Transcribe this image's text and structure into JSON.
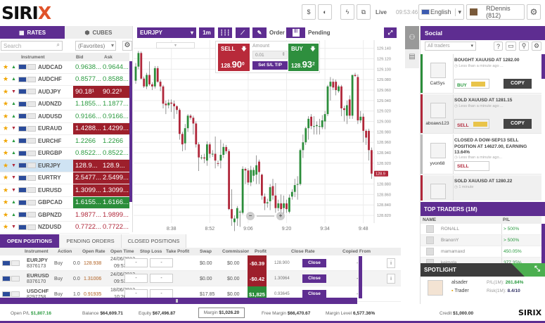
{
  "header": {
    "logo": "SIRIX",
    "live": "Live",
    "clock": "09:53:46",
    "language": "English",
    "user": "RDennis (812)"
  },
  "rates": {
    "tabs": [
      "RATES",
      "CUBES"
    ],
    "search_placeholder": "Search",
    "filter": "(Favorites)",
    "columns": [
      "Instrument",
      "Bid",
      "Ask"
    ],
    "rows": [
      {
        "ins": "AUDCAD",
        "dir": "up",
        "bid": "0.9638...",
        "ask": "0.9644...",
        "style": "up"
      },
      {
        "ins": "AUDCHF",
        "dir": "up",
        "bid": "0.8577...",
        "ask": "0.8588...",
        "style": "up"
      },
      {
        "ins": "AUDJPY",
        "dir": "down",
        "bid": "90.18¹",
        "ask": "90.22³",
        "style": "red"
      },
      {
        "ins": "AUDNZD",
        "dir": "up",
        "bid": "1.1855...",
        "ask": "1.1877...",
        "style": "up"
      },
      {
        "ins": "AUDUSD",
        "dir": "up",
        "bid": "0.9166...",
        "ask": "0.9166...",
        "style": "up"
      },
      {
        "ins": "EURAUD",
        "dir": "down",
        "bid": "1.4288...",
        "ask": "1.4299...",
        "style": "red"
      },
      {
        "ins": "EURCHF",
        "dir": "up",
        "bid": "1.2266",
        "ask": "1.2266",
        "style": "up"
      },
      {
        "ins": "EURGBP",
        "dir": "up",
        "bid": "0.8522...",
        "ask": "0.8522...",
        "style": "up"
      },
      {
        "ins": "EURJPY",
        "dir": "down",
        "bid": "128.9...",
        "ask": "128.9...",
        "style": "red"
      },
      {
        "ins": "EURTRY",
        "dir": "down",
        "bid": "2.5477...",
        "ask": "2.5499...",
        "style": "red"
      },
      {
        "ins": "EURUSD",
        "dir": "down",
        "bid": "1.3099...",
        "ask": "1.3099...",
        "style": "red"
      },
      {
        "ins": "GBPCAD",
        "dir": "up",
        "bid": "1.6155...",
        "ask": "1.6166...",
        "style": "green"
      },
      {
        "ins": "GBPNZD",
        "dir": "up",
        "bid": "1.9877...",
        "ask": "1.9899...",
        "style": "dn"
      },
      {
        "ins": "NZDUSD",
        "dir": "down",
        "bid": "0.7722...",
        "ask": "0.7722...",
        "style": "dn"
      }
    ]
  },
  "chart_toolbar": {
    "symbol": "EURJPY",
    "timeframe": "1m",
    "order": "Order",
    "pending": "Pending"
  },
  "trade_box": {
    "sell_label": "SELL",
    "sell_price_main": "128.",
    "sell_price_big": "90",
    "sell_price_sup": "0",
    "amount_label": "Amount",
    "amount_value": "0.01",
    "sltp": "Set S/L T/P",
    "buy_label": "BUY",
    "buy_price_main": "128.",
    "buy_price_big": "93",
    "buy_price_sup": "2"
  },
  "chart_data": {
    "type": "candlestick",
    "symbol": "EURJPY",
    "interval": "1m",
    "start_time": "8:25",
    "x_ticks": [
      "8:38",
      "8:52",
      "9:06",
      "9:20",
      "9:34",
      "9:48"
    ],
    "y_ticks": [
      "129.140",
      "129.120",
      "129.100",
      "129.080",
      "129.060",
      "129.040",
      "129.020",
      "129.000",
      "128.980",
      "128.960",
      "128.940",
      "128.920",
      "128.880",
      "128.860",
      "128.840",
      "128.820"
    ],
    "ylim": [
      128.812,
      129.149
    ],
    "current_price_label": "128.9",
    "current_price": 128.9,
    "grid": true,
    "up_color": "#2b8d3a",
    "down_color": "#b0273a",
    "ohlc": [
      [
        129.078,
        129.112,
        129.072,
        129.105
      ],
      [
        129.105,
        129.135,
        129.1,
        129.131
      ],
      [
        129.131,
        129.134,
        129.08,
        129.082
      ],
      [
        129.082,
        129.086,
        129.064,
        129.067
      ],
      [
        129.067,
        129.093,
        129.062,
        129.089
      ],
      [
        129.089,
        129.115,
        129.068,
        129.071
      ],
      [
        129.071,
        129.075,
        129.06,
        129.067
      ],
      [
        129.067,
        129.106,
        129.063,
        129.102
      ],
      [
        129.102,
        129.106,
        129.074,
        129.076
      ],
      [
        129.076,
        129.08,
        129.058,
        129.067
      ],
      [
        129.067,
        129.07,
        129.025,
        129.034
      ],
      [
        129.034,
        129.04,
        129.014,
        129.031
      ],
      [
        129.031,
        129.042,
        129.025,
        129.036
      ],
      [
        129.036,
        129.042,
        129.018,
        129.034
      ],
      [
        129.034,
        129.04,
        129.005,
        129.029
      ],
      [
        129.029,
        129.031,
        129.014,
        129.022
      ],
      [
        129.022,
        129.025,
        128.965,
        128.976
      ],
      [
        128.976,
        128.98,
        128.943,
        128.956
      ],
      [
        128.958,
        128.995,
        128.945,
        128.987
      ],
      [
        128.987,
        129.014,
        128.98,
        129.011
      ],
      [
        129.011,
        129.014,
        129.003,
        129.007
      ],
      [
        129.007,
        129.011,
        128.975,
        128.996
      ],
      [
        128.996,
        129.0,
        128.95,
        128.956
      ],
      [
        128.956,
        128.96,
        128.905,
        128.931
      ],
      [
        128.931,
        128.936,
        128.927,
        128.931
      ],
      [
        128.931,
        128.938,
        128.92,
        128.929
      ],
      [
        128.925,
        128.962,
        128.915,
        128.956
      ],
      [
        128.956,
        128.96,
        128.93,
        128.938
      ],
      [
        128.938,
        128.945,
        128.932,
        128.938
      ],
      [
        128.938,
        128.971,
        128.91,
        128.925
      ],
      [
        128.92,
        128.925,
        128.914,
        128.919
      ],
      [
        128.925,
        128.965,
        128.91,
        128.936
      ],
      [
        128.936,
        128.958,
        128.93,
        128.951
      ],
      [
        128.951,
        128.955,
        128.938,
        128.943
      ],
      [
        128.943,
        128.947,
        128.83,
        128.832
      ],
      [
        128.832,
        128.87,
        128.8,
        128.814
      ],
      [
        128.807,
        128.82,
        128.79,
        128.814
      ],
      [
        128.814,
        128.838,
        128.8,
        128.834
      ],
      [
        128.827,
        128.83,
        128.798,
        128.827
      ],
      [
        128.825,
        128.914,
        128.822,
        128.909
      ],
      [
        128.909,
        128.912,
        128.88,
        128.906
      ],
      [
        128.906,
        128.91,
        128.878,
        128.883
      ],
      [
        128.883,
        128.915,
        128.876,
        128.907
      ],
      [
        128.896,
        128.912,
        128.885,
        128.907
      ],
      [
        128.898,
        128.935,
        128.88,
        128.916
      ],
      [
        128.923,
        128.927,
        128.88,
        128.903
      ],
      [
        128.898,
        128.9,
        128.85,
        128.858
      ],
      [
        128.856,
        128.862,
        128.83,
        128.843
      ],
      [
        128.843,
        128.852,
        128.835,
        128.845
      ],
      [
        128.847,
        128.88,
        128.83,
        128.874
      ],
      [
        128.876,
        128.89,
        128.85,
        128.858
      ],
      [
        128.858,
        128.882,
        128.825,
        128.834
      ],
      [
        128.834,
        128.85,
        128.828,
        128.843
      ],
      [
        128.843,
        128.86,
        128.822,
        128.832
      ],
      [
        128.834,
        128.858,
        128.82,
        128.843
      ],
      [
        128.843,
        128.85,
        128.825,
        128.832
      ],
      [
        128.827,
        128.86,
        128.824,
        128.854
      ],
      [
        128.856,
        128.87,
        128.85,
        128.865
      ],
      [
        128.865,
        128.89,
        128.855,
        128.878
      ],
      [
        128.88,
        128.895,
        128.85,
        128.88
      ],
      [
        128.88,
        128.948,
        128.877,
        128.945
      ],
      [
        128.945,
        128.975,
        128.93,
        128.96
      ],
      [
        128.96,
        128.99,
        128.955,
        128.987
      ],
      [
        128.987,
        129.01,
        128.965,
        129.005
      ],
      [
        129.009,
        129.014,
        128.985,
        128.991
      ],
      [
        128.991,
        129.01,
        128.975,
        128.991
      ],
      [
        128.991,
        129.0,
        128.975,
        128.993
      ],
      [
        128.991,
        129.005,
        128.975,
        128.991
      ],
      [
        128.989,
        129.012,
        128.985,
        129.002
      ],
      [
        129.0,
        129.02,
        128.985,
        129.014
      ],
      [
        129.014,
        129.07,
        129.01,
        129.067
      ],
      [
        129.067,
        129.085,
        129.04,
        129.076
      ],
      [
        129.076,
        129.082,
        129.06,
        129.065
      ],
      [
        129.076,
        129.08,
        129.05,
        129.06
      ],
      [
        129.058,
        129.07,
        129.055,
        129.067
      ],
      [
        129.067,
        129.07,
        129.01,
        129.025
      ],
      [
        129.025,
        129.03,
        129.0,
        129.022
      ],
      [
        129.011,
        129.04,
        128.995,
        129.031
      ],
      [
        129.042,
        129.05,
        129.005,
        129.011
      ],
      [
        129.011,
        129.089,
        129.005,
        129.089
      ],
      [
        129.089,
        129.093,
        129.085,
        129.087
      ],
      [
        129.085,
        129.09,
        128.995,
        129.002
      ],
      [
        129.002,
        129.02,
        128.997,
        129.009
      ],
      [
        129.009,
        129.015,
        128.96,
        128.982
      ],
      [
        128.982,
        128.985,
        128.955,
        128.969
      ],
      [
        128.982,
        128.986,
        128.925,
        128.945
      ],
      [
        128.945,
        128.95,
        128.89,
        128.9
      ]
    ]
  },
  "social": {
    "title": "Social",
    "filter": "All traders",
    "feed": [
      {
        "user": "CatSys",
        "title": "BOUGHT XAUUSD AT 1282.00",
        "time": "Less than a minute ago ...",
        "action": "BUY",
        "copy": "COPY",
        "color": "#2b8d3a"
      },
      {
        "user": "aboaws123",
        "title": "SOLD XAUUSD AT 1281.15",
        "time": "Less than a minute ago ...",
        "action": "SELL",
        "copy": "COPY",
        "color": "#b0273a"
      },
      {
        "user": "yvon68",
        "title": "CLOSED A DOW-SEP13 SELL POSITION AT 14627.00, EARNING 13.64%",
        "time": "Less than a minute ago...",
        "action": "SELL",
        "color": "#bbbbbb"
      },
      {
        "user": "",
        "title": "SOLD XAUUSD AT 1280.22",
        "time": "1 minute",
        "color": "#b0273a"
      }
    ]
  },
  "top_traders": {
    "title": "TOP TRADERS (1M)",
    "columns": [
      "NAME",
      "P/L"
    ],
    "rows": [
      {
        "name": "RONALL",
        "pl": "> 500%"
      },
      {
        "name": "BranonY",
        "pl": "> 500%"
      },
      {
        "name": "mamamaxd",
        "pl": "450.05%"
      },
      {
        "name": "keimola",
        "pl": "377.35%"
      }
    ]
  },
  "spotlight": {
    "title": "SPOTLIGHT",
    "name": "alsader",
    "role": "Trader",
    "pl_label": "P/L(1M):",
    "pl": "261.84%",
    "risk_label": "Risk(1M):",
    "risk": "8.4/10"
  },
  "positions": {
    "tabs": [
      "OPEN POSITIONS",
      "PENDING ORDERS",
      "CLOSED POSITIONS"
    ],
    "columns": [
      "Instrument",
      "Action",
      "Open Rate",
      "Open Time",
      "Stop Loss",
      "Take Profit",
      "Swap",
      "Commission",
      "Profit",
      "Close Rate",
      "Copied From"
    ],
    "rows": [
      {
        "ins": "EURJPY",
        "id": "8376173",
        "action": "Buy",
        "amt": "0.0",
        "rate": "128.938",
        "date": "24/06/2013",
        "time": "09:53:36",
        "sl": "-",
        "tp": "-",
        "swap": "$0.00",
        "comm": "$0.00",
        "profit": "-$0.39",
        "pstyle": "red",
        "close_rate": "128.900",
        "close": "Close",
        "copied": "-"
      },
      {
        "ins": "EURUSD",
        "id": "8376170",
        "action": "Buy",
        "amt": "0.0",
        "rate": "1.31006",
        "date": "24/06/2013",
        "time": "09:53:30",
        "sl": "-",
        "tp": "-",
        "swap": "$0.00",
        "comm": "$0.00",
        "profit": "-$0.42",
        "pstyle": "red",
        "close_rate": "1.30964",
        "close": "Close",
        "copied": "-"
      },
      {
        "ins": "USDCHF",
        "id": "8297758",
        "action": "Buy",
        "amt": "1.0",
        "rate": "0.91935",
        "date": "18/06/2013",
        "time": "10:26:18",
        "sl": "-",
        "tp": "-",
        "swap": "$17.85",
        "comm": "$0.00",
        "profit": "$1,825",
        "pstyle": "green",
        "close_rate": "0.93645",
        "close": "Close",
        "copied": "-"
      }
    ]
  },
  "footer": {
    "open_pl_label": "Open P/L",
    "open_pl": "$1,807.16",
    "balance_label": "Balance",
    "balance": "$64,609.71",
    "equity_label": "Equity",
    "equity": "$67,496.87",
    "margin_label": "Margin",
    "margin": "$1,026.20",
    "free_margin_label": "Free Margin",
    "free_margin": "$66,470.67",
    "margin_level_label": "Margin Level",
    "margin_level": "6,577.36%",
    "credit_label": "Credit",
    "credit": "$1,000.00",
    "logo": "SIRIX"
  }
}
